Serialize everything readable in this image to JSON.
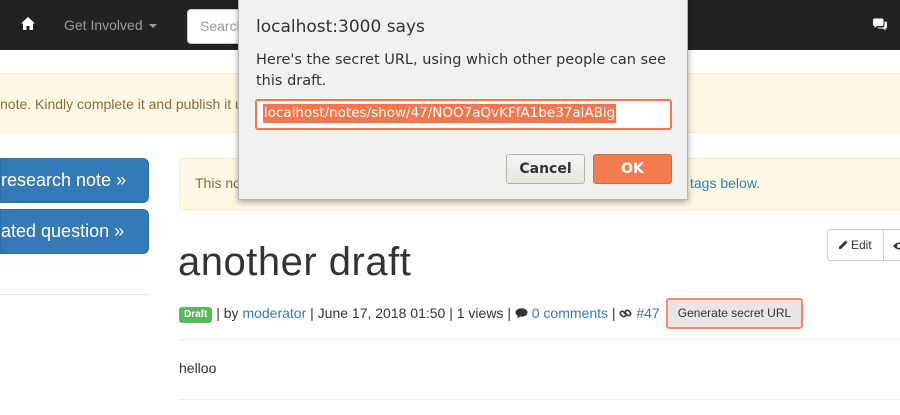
{
  "navbar": {
    "home_icon": "home-icon",
    "get_involved": "Get Involved",
    "search_placeholder": "Search",
    "chat_icon": "chat-icon"
  },
  "draft_banner": {
    "text": "note. Kindly complete it and publish it u"
  },
  "sidebar": {
    "research_note_button": "research note »",
    "related_question_button": "ated question »"
  },
  "main_alert": {
    "text": "This no",
    "link": "tags below."
  },
  "note": {
    "edit_label": "Edit",
    "title": "another draft",
    "badge": "Draft",
    "by_text": "| by",
    "author": "moderator",
    "details": "| June 17, 2018 01:50 | 1 views |",
    "comments": "0 comments",
    "sep": "|",
    "note_id": "#47",
    "generate_button": "Generate secret URL",
    "body": "helloo"
  },
  "dialog": {
    "title": "localhost:3000 says",
    "message": "Here's the secret URL, using which other people can see this draft.",
    "input_value": "localhost/notes/show/47/NOO7aQvKFfA1be37alABig",
    "cancel_label": "Cancel",
    "ok_label": "OK"
  },
  "colors": {
    "navbar": "#222222",
    "primary": "#337ab7",
    "warning_bg": "#fcf8e3",
    "dialog_accent": "#f47d4f",
    "draft_badge": "#5cb85c"
  }
}
